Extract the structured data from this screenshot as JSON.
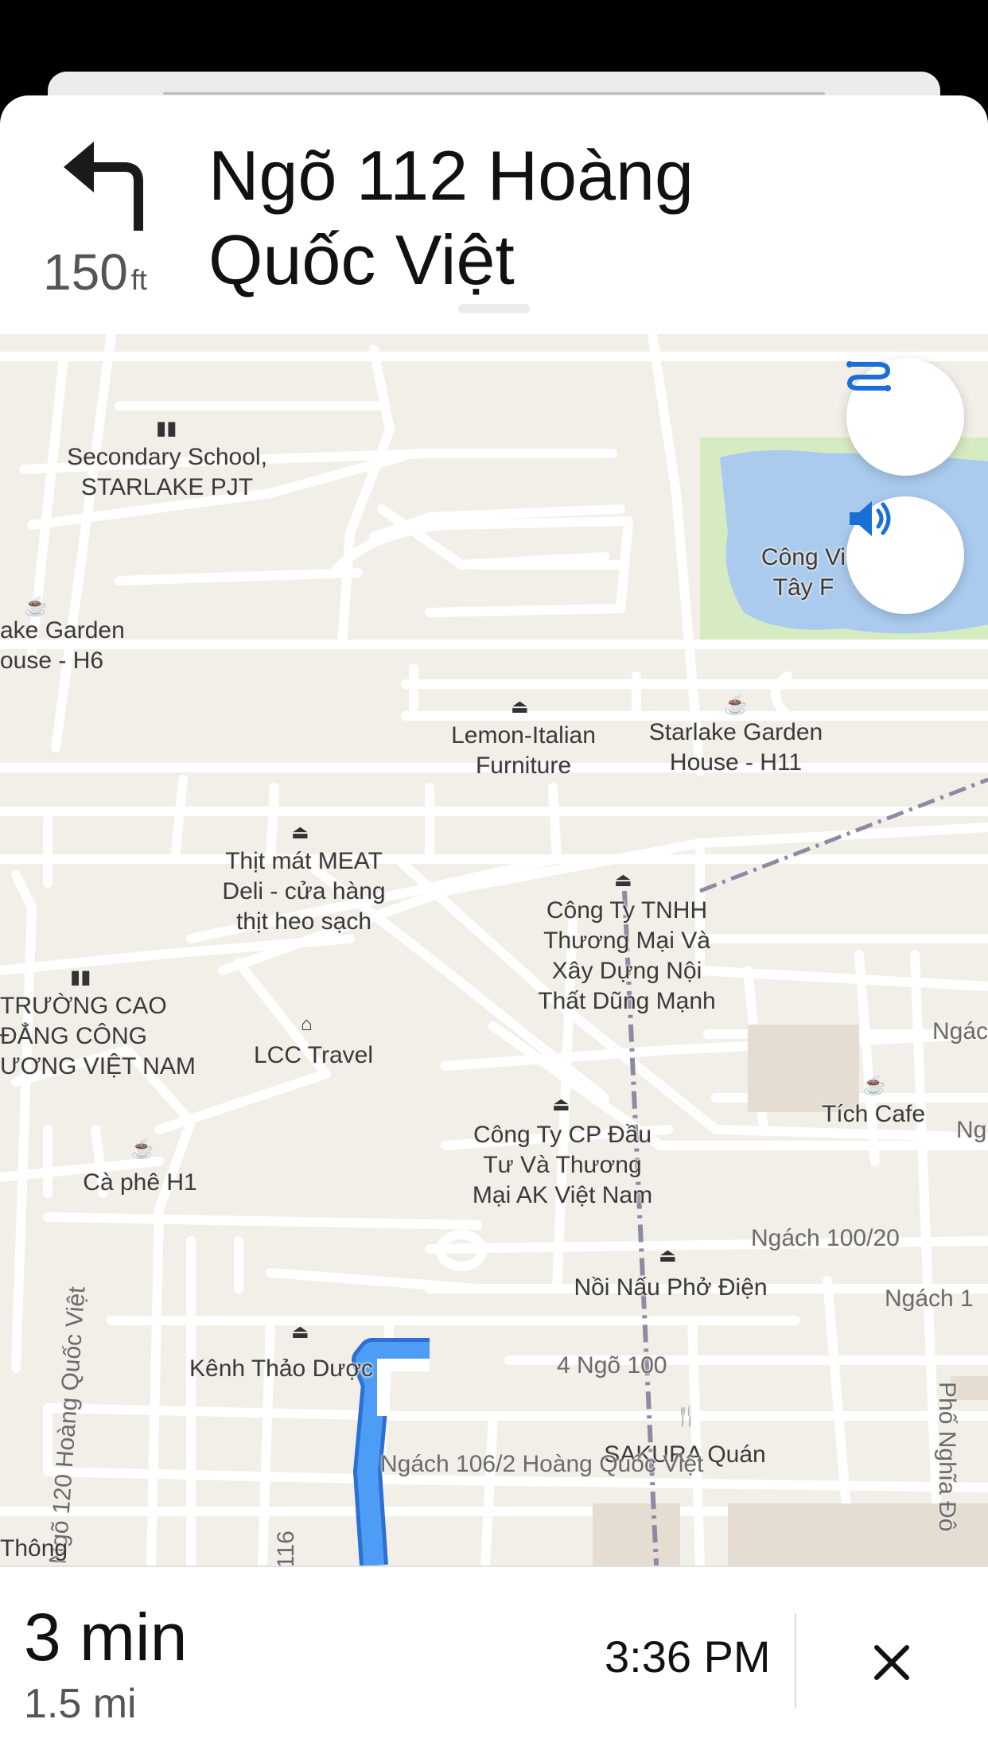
{
  "guidance": {
    "maneuver_icon": "turn-left-arrow-icon",
    "distance_value": "150",
    "distance_unit": "ft",
    "street_line1": "Ngõ 112 Hoàng",
    "street_line2": "Quốc Việt"
  },
  "map": {
    "pois": [
      {
        "id": "secondary-school",
        "label1": "Secondary School,",
        "label2": "STARLAKE PJT",
        "label3": "",
        "icon": "school-icon"
      },
      {
        "id": "starlake-h6",
        "label1": "ake Garden",
        "label2": "ouse - H6",
        "label3": "",
        "icon": "cafe-icon"
      },
      {
        "id": "cong-vien",
        "label1": "Công Vi",
        "label2": "Tây F",
        "label3": "",
        "icon": "park-icon"
      },
      {
        "id": "lemon-italian",
        "label1": "Lemon-Italian",
        "label2": "Furniture",
        "label3": "",
        "icon": "shopping-bag-icon"
      },
      {
        "id": "starlake-h11",
        "label1": "Starlake Garden",
        "label2": "House - H11",
        "label3": "",
        "icon": "cafe-icon"
      },
      {
        "id": "thit-mat",
        "label1": "Thịt mát MEAT",
        "label2": "Deli - cửa hàng",
        "label3": "thịt heo sạch",
        "icon": "shopping-bag-icon"
      },
      {
        "id": "cong-ty-tnhh",
        "label1": "Công Ty TNHH",
        "label2": "Thương Mại Và",
        "label3": "Xây Dựng Nội",
        "label4": "Thất Dũng Mạnh",
        "icon": "shopping-bag-icon"
      },
      {
        "id": "truong-cao-dang",
        "label1": "TRƯỜNG CAO",
        "label2": "ĐẲNG CÔNG",
        "label3": "ƯƠNG VIỆT NAM",
        "icon": "school-icon"
      },
      {
        "id": "lcc-travel",
        "label1": "LCC Travel",
        "label2": "",
        "label3": "",
        "icon": "travel-agency-icon"
      },
      {
        "id": "tich-cafe",
        "label1": "Tích Cafe",
        "label2": "",
        "label3": "",
        "icon": "cafe-icon"
      },
      {
        "id": "cong-ty-cp",
        "label1": "Công Ty CP Đầu",
        "label2": "Tư Và Thương",
        "label3": "Mại AK Việt Nam",
        "icon": "shopping-bag-icon"
      },
      {
        "id": "ca-phe-h1",
        "label1": "Cà phê H1",
        "label2": "",
        "label3": "",
        "icon": "cafe-icon"
      },
      {
        "id": "noi-nau-pho",
        "label1": "Nồi Nấu Phở Điện",
        "label2": "",
        "label3": "",
        "icon": "shopping-bag-icon"
      },
      {
        "id": "kenh-thao-duoc",
        "label1": "Kênh Thảo Dược",
        "label2": "",
        "label3": "",
        "icon": "shopping-bag-icon"
      },
      {
        "id": "sakura-quan",
        "label1": "SAKURA Quán",
        "label2": "",
        "label3": "",
        "icon": "restaurant-icon"
      }
    ],
    "streets": {
      "ngach_100_20": "Ngách 100/20",
      "ngach_1": "Ngách 1",
      "ngo_100": "Ngõ 100",
      "ngo_100_prefix": "4",
      "ngach_106_2": "Ngách 106/2 Hoàng Quốc Việt",
      "ngo_120": "Ngõ 120 Hoàng Quốc Việt",
      "pho_nghia_do": "Phố Nghĩa Đô",
      "ngo_116": "ỗ 116",
      "thong": "Thông",
      "ngac_top": "Ngác",
      "ng_mid": "Ng"
    },
    "buttons": {
      "route_overview_icon": "route-overview-icon",
      "audio_icon": "speaker-volume-icon"
    }
  },
  "footer": {
    "eta_minutes": "3 min",
    "eta_distance": "1.5 mi",
    "arrival_time": "3:36 PM",
    "close_icon": "close-icon"
  },
  "colors": {
    "route_blue": "#3d8ef0",
    "accent_blue": "#1a6fd6",
    "map_background": "#f2efe9",
    "park_green": "#d6ebc2",
    "water_blue": "#aacbee"
  }
}
